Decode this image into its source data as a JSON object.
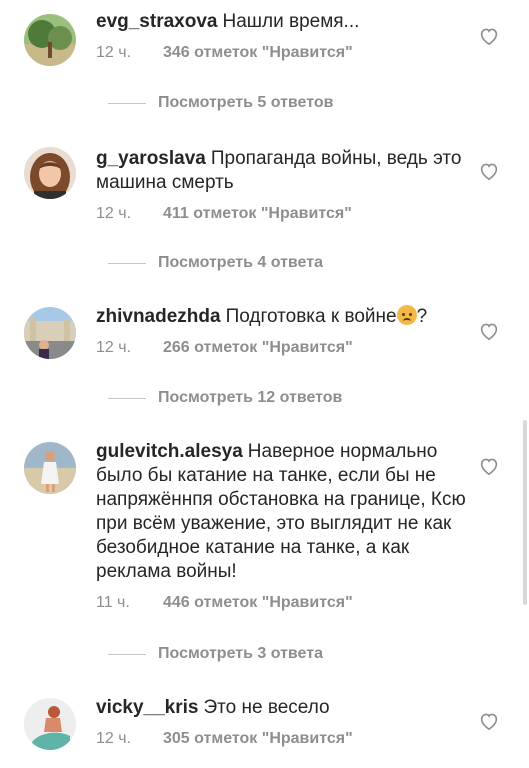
{
  "comments": [
    {
      "username": "evg_straxova",
      "text": "Нашли время...",
      "time": "12 ч.",
      "likes": "346 отметок \"Нравится\"",
      "replies": "Посмотреть 5 ответов"
    },
    {
      "username": "g_yaroslava",
      "text": "Пропаганда войны, ведь это машина смерть",
      "time": "12 ч.",
      "likes": "411 отметок \"Нравится\"",
      "replies": "Посмотреть 4 ответа"
    },
    {
      "username": "zhivnadezhda",
      "text": "Подготовка к войне",
      "text_suffix": "?",
      "emoji": "crying-face-emoji",
      "time": "12 ч.",
      "likes": "266 отметок \"Нравится\"",
      "replies": "Посмотреть 12 ответов"
    },
    {
      "username": "gulevitch.alesya",
      "text": "Наверное нормально было бы катание на танке, если бы не напряжённпя обстановка на границе, Ксю при всём уважение, это выглядит не как безобидное катание на танке, а как реклама войны!",
      "time": "11 ч.",
      "likes": "446 отметок \"Нравится\"",
      "replies": "Посмотреть 3 ответа"
    },
    {
      "username": "vicky__kris",
      "text": "Это не весело",
      "time": "12 ч.",
      "likes": "305 отметок \"Нравится\""
    }
  ],
  "icons": {
    "like": "heart-outline-icon"
  },
  "colors": {
    "text": "#262626",
    "secondary": "#8e8e8e",
    "divider": "#c7c7c7"
  }
}
